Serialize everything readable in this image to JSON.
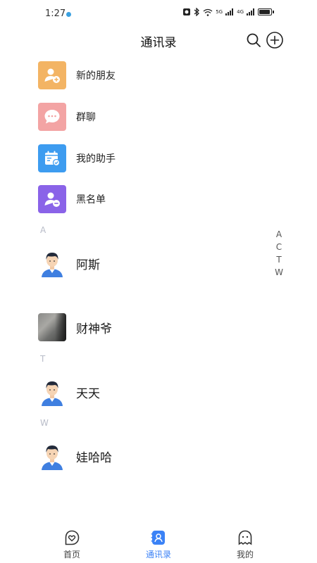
{
  "status_bar": {
    "time": "1:27",
    "network_labels": [
      "5G",
      "4G"
    ]
  },
  "header": {
    "title": "通讯录",
    "search_icon": "search-icon",
    "add_icon": "plus-circle-icon"
  },
  "menu": [
    {
      "label": "新的朋友",
      "icon": "add-friend-icon",
      "color": "#f3b464"
    },
    {
      "label": "群聊",
      "icon": "chat-bubble-icon",
      "color": "#f3a4a4"
    },
    {
      "label": "我的助手",
      "icon": "calendar-check-icon",
      "color": "#3d9cf0"
    },
    {
      "label": "黑名单",
      "icon": "block-user-icon",
      "color": "#8a63e8"
    }
  ],
  "sections": [
    {
      "letter": "A",
      "contacts": [
        {
          "name": "阿斯"
        },
        {
          "name": "财神爷"
        }
      ]
    },
    {
      "letter": "T",
      "contacts": [
        {
          "name": "天天"
        }
      ]
    },
    {
      "letter": "W",
      "contacts": [
        {
          "name": "娃哈哈"
        }
      ]
    }
  ],
  "index_bar": [
    "A",
    "C",
    "T",
    "W"
  ],
  "bottom_nav": [
    {
      "label": "首页",
      "icon": "home-heart-icon",
      "active": false
    },
    {
      "label": "通讯录",
      "icon": "contacts-icon",
      "active": true
    },
    {
      "label": "我的",
      "icon": "ghost-profile-icon",
      "active": false
    }
  ],
  "colors": {
    "accent": "#3b82f6",
    "section_letter": "#b8bcc8"
  }
}
